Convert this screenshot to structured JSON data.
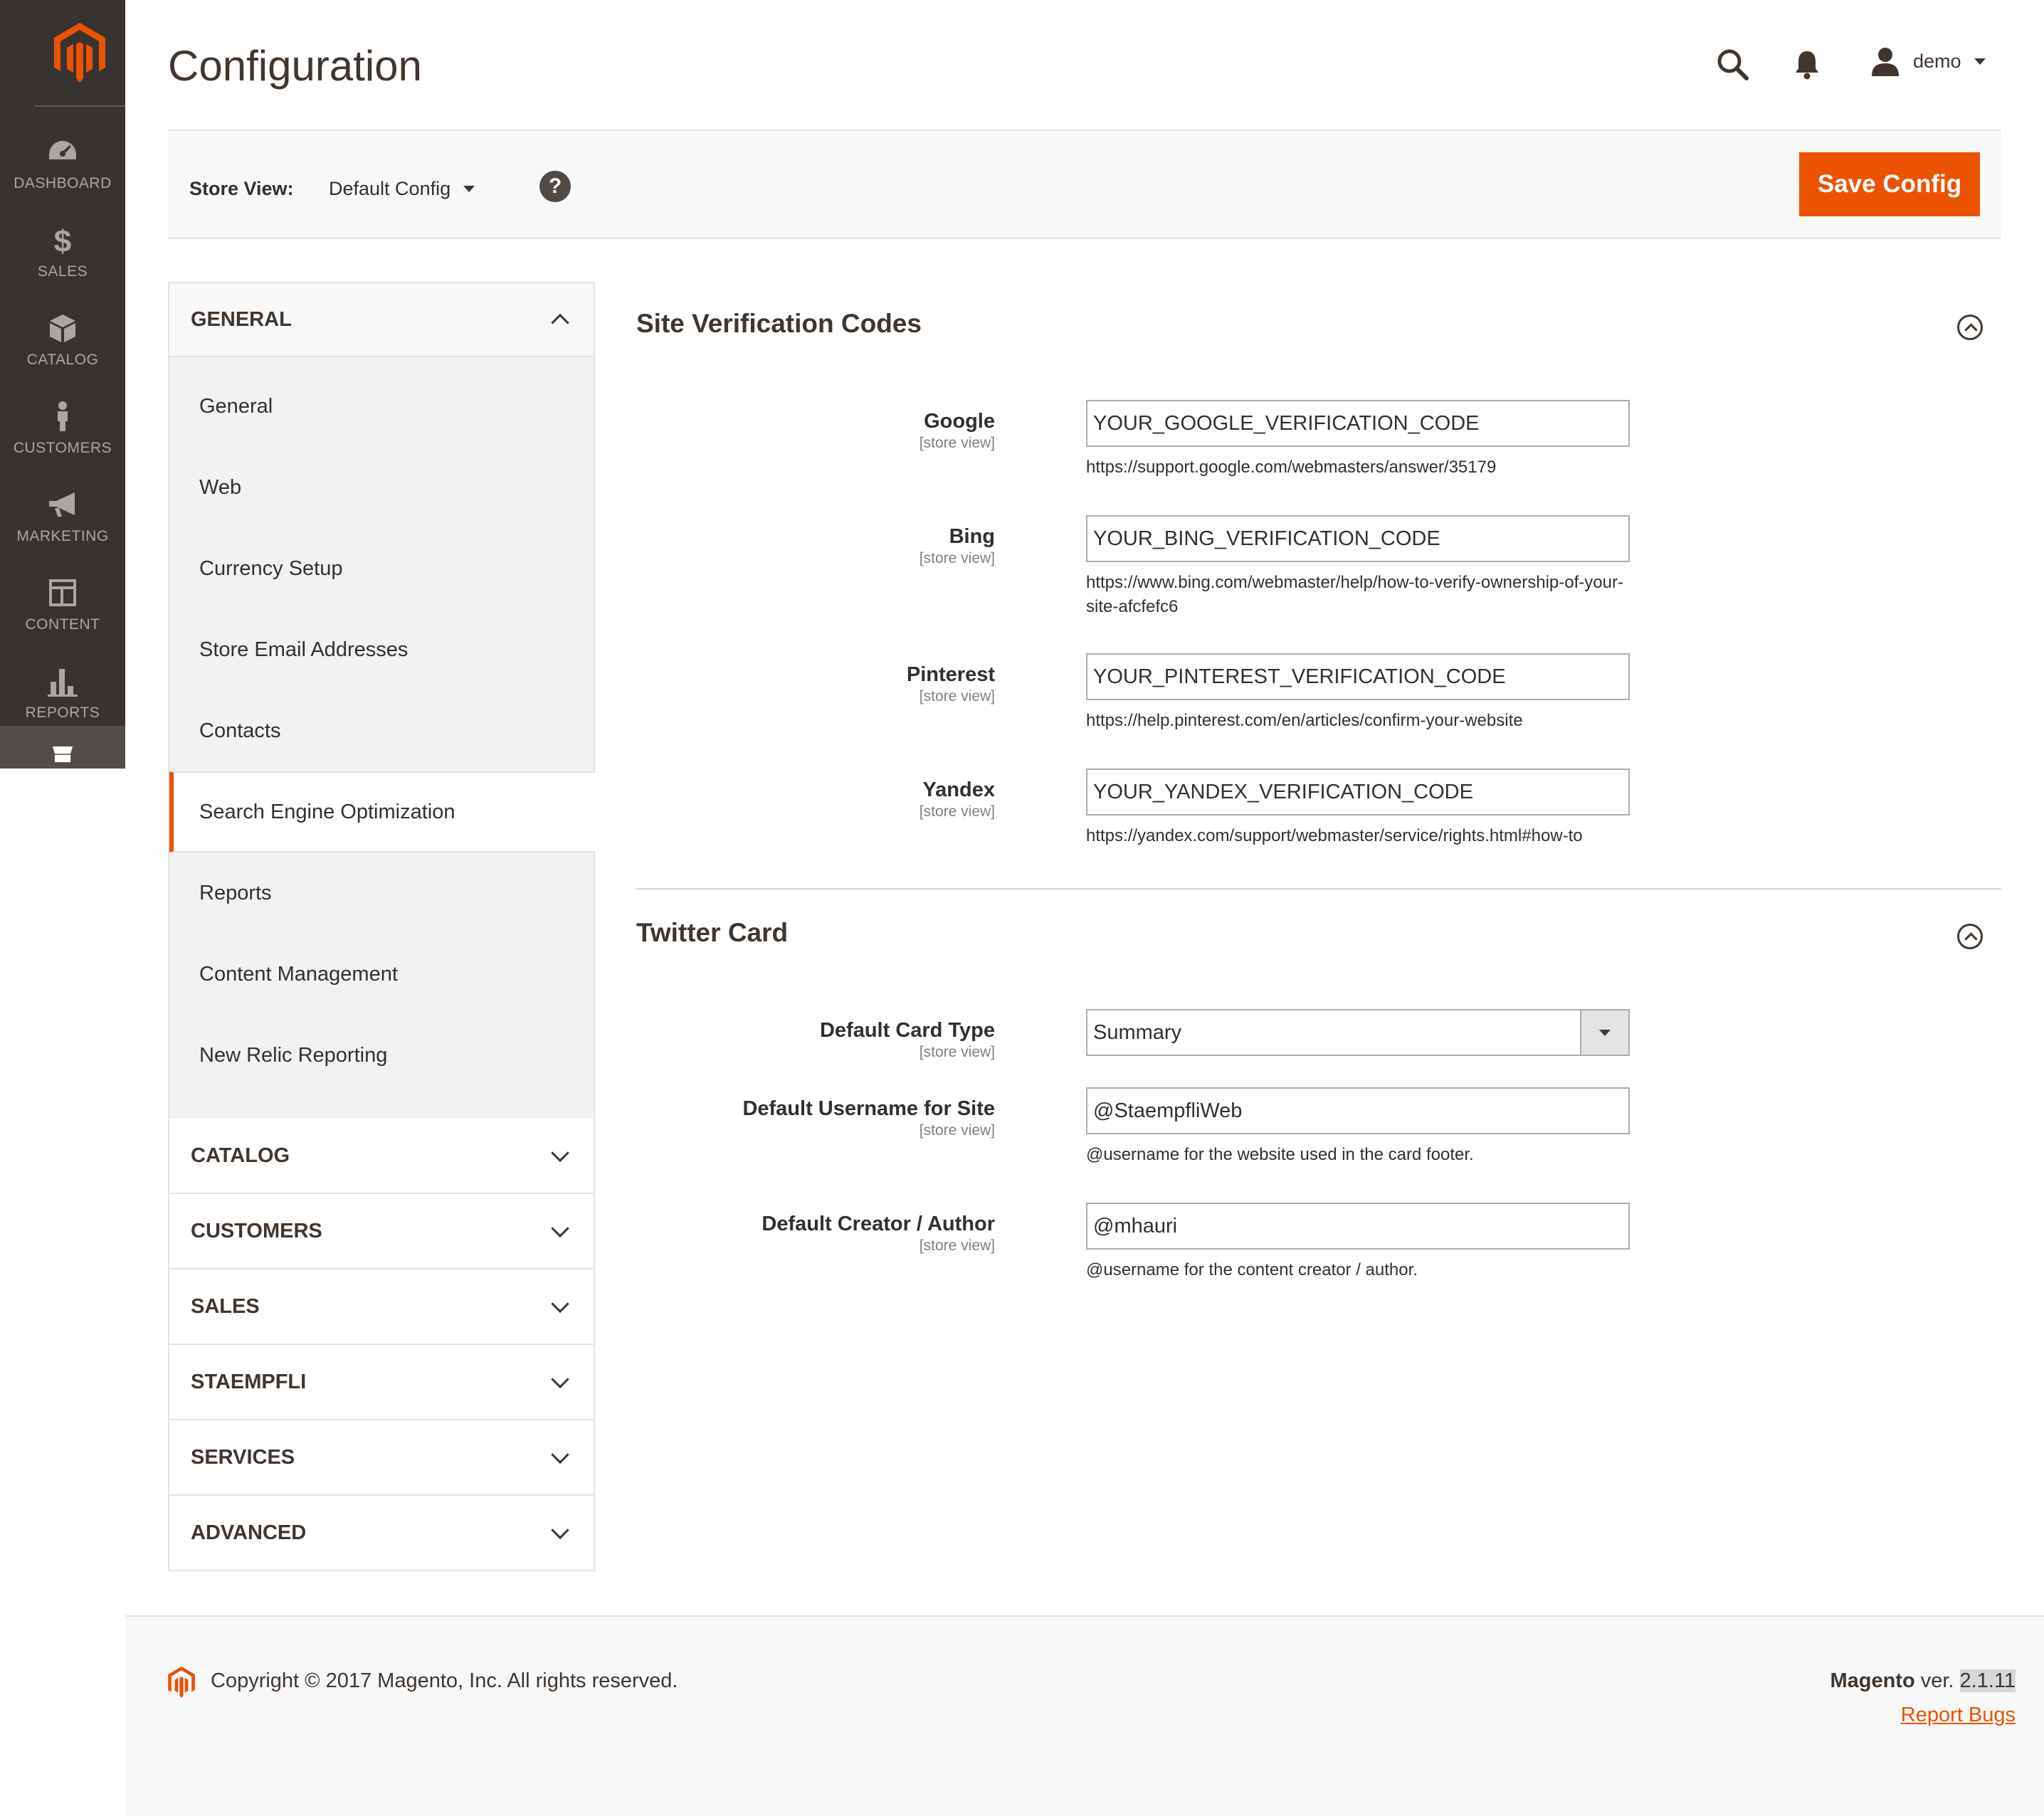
{
  "colors": {
    "accent": "#eb5202",
    "rail": "#373330",
    "text": "#41362f"
  },
  "rail": {
    "items": [
      {
        "label": "DASHBOARD",
        "icon": "dashboard-icon"
      },
      {
        "label": "SALES",
        "icon": "dollar-icon"
      },
      {
        "label": "CATALOG",
        "icon": "cube-icon"
      },
      {
        "label": "CUSTOMERS",
        "icon": "person-icon"
      },
      {
        "label": "MARKETING",
        "icon": "megaphone-icon"
      },
      {
        "label": "CONTENT",
        "icon": "layout-icon"
      },
      {
        "label": "REPORTS",
        "icon": "bar-chart-icon"
      },
      {
        "label": "",
        "icon": "store-icon"
      }
    ]
  },
  "header": {
    "title": "Configuration",
    "user": "demo"
  },
  "store_bar": {
    "label": "Store View:",
    "value": "Default Config",
    "help": "?",
    "save_label": "Save Config"
  },
  "tabs": {
    "general": {
      "title": "GENERAL",
      "items": [
        "General",
        "Web",
        "Currency Setup",
        "Store Email Addresses",
        "Contacts",
        "Search Engine Optimization",
        "Reports",
        "Content Management",
        "New Relic Reporting"
      ],
      "active": "Search Engine Optimization"
    },
    "collapsed": [
      "CATALOG",
      "CUSTOMERS",
      "SALES",
      "STAEMPFLI",
      "SERVICES",
      "ADVANCED"
    ]
  },
  "sections": {
    "verification": {
      "title": "Site Verification Codes",
      "fields": [
        {
          "label": "Google",
          "scope": "[store view]",
          "value": "YOUR_GOOGLE_VERIFICATION_CODE",
          "note": "https://support.google.com/webmasters/answer/35179"
        },
        {
          "label": "Bing",
          "scope": "[store view]",
          "value": "YOUR_BING_VERIFICATION_CODE",
          "note": "https://www.bing.com/webmaster/help/how-to-verify-ownership-of-your-site-afcfefc6"
        },
        {
          "label": "Pinterest",
          "scope": "[store view]",
          "value": "YOUR_PINTEREST_VERIFICATION_CODE",
          "note": "https://help.pinterest.com/en/articles/confirm-your-website"
        },
        {
          "label": "Yandex",
          "scope": "[store view]",
          "value": "YOUR_YANDEX_VERIFICATION_CODE",
          "note": "https://yandex.com/support/webmaster/service/rights.html#how-to"
        }
      ]
    },
    "twitter": {
      "title": "Twitter Card",
      "fields": [
        {
          "label": "Default Card Type",
          "scope": "[store view]",
          "value": "Summary"
        },
        {
          "label": "Default Username for Site",
          "scope": "[store view]",
          "value": "@StaempfliWeb",
          "note": "@username for the website used in the card footer."
        },
        {
          "label": "Default Creator / Author",
          "scope": "[store view]",
          "value": "@mhauri",
          "note": "@username for the content creator / author."
        }
      ]
    }
  },
  "footer": {
    "copyright": "Copyright © 2017 Magento, Inc. All rights reserved.",
    "brand": "Magento",
    "ver_label": " ver. ",
    "version": "2.1.11",
    "report_bugs": "Report Bugs"
  }
}
